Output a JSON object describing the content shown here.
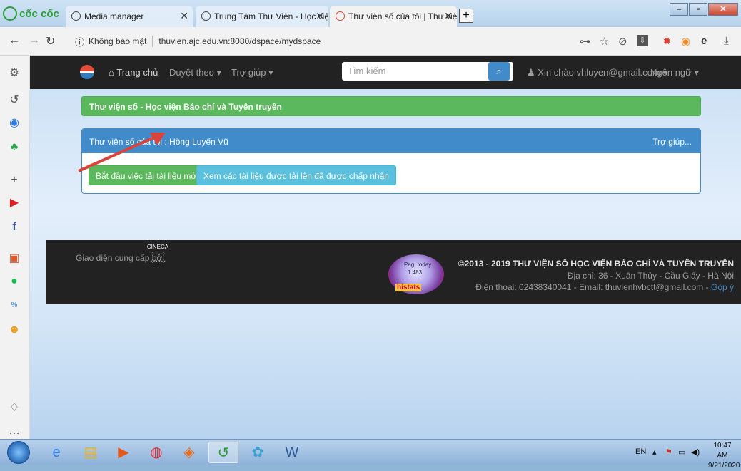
{
  "browser": {
    "brand": "cốc cốc",
    "tabs": [
      {
        "title": "Media manager",
        "active": false
      },
      {
        "title": "Trung Tâm Thư Viện - Học việ",
        "active": false
      },
      {
        "title": "Thư viện số của tôi | Thư viện",
        "active": true
      }
    ],
    "url_security": "Không bảo mật",
    "url": "thuvien.ajc.edu.vn:8080/dspace/mydspace"
  },
  "navbar": {
    "home": "Trang chủ",
    "browse": "Duyệt theo ▾",
    "help": "Trợ giúp ▾",
    "search_placeholder": "Tìm kiếm",
    "greeting": "Xin chào vhluyen@gmail.com ▾",
    "language": "Ngôn ngữ ▾"
  },
  "banner": "Thư viện số - Học viện Báo chí và Tuyên truyền",
  "panel": {
    "title": "Thư viện số của tôi : Hồng Luyến Vũ",
    "help": "Trợ giúp...",
    "start_button": "Bắt đầu việc tải tài liệu mới",
    "view_button": "Xem các tài liệu được tải lên đã được chấp nhận"
  },
  "footer": {
    "credit": "Giao diện cung cấp bởi",
    "cineca": "CINECA",
    "stats_label": "Pag. today",
    "stats_count": "1 483",
    "stats_brand": "histats",
    "copyright": "©2013 - 2019 THƯ VIỆN SỐ HỌC VIỆN BÁO CHÍ VÀ TUYÊN TRUYỀN",
    "address": "Địa chỉ: 36 - Xuân Thủy - Cầu Giấy - Hà Nội",
    "contact": "Điện thoại: 02438340041 - Email: thuvienhvbctt@gmail.com - ",
    "feedback": "Góp ý"
  },
  "taskbar": {
    "lang": "EN",
    "time": "10:47 AM",
    "date": "9/21/2020"
  },
  "colors": {
    "green": "#5cb85c",
    "blue": "#428bca",
    "navbar": "#222222",
    "arrow": "#d9443a"
  }
}
